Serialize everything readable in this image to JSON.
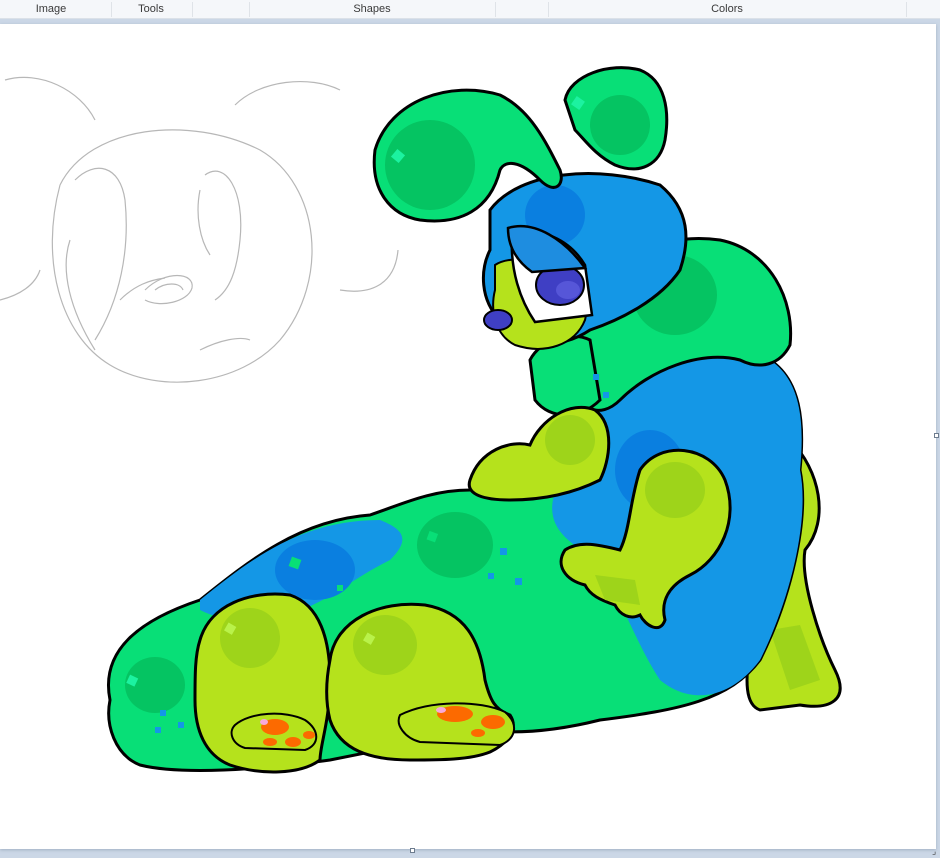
{
  "ribbon": {
    "groups": [
      {
        "label": "Image"
      },
      {
        "label": "Tools"
      },
      {
        "label": "Shapes"
      },
      {
        "label": "Colors"
      }
    ]
  },
  "palette": {
    "outline": "#000000",
    "body_green": "#08df77",
    "spot_green": "#05c462",
    "body_blue": "#1497e6",
    "spot_blue": "#0a7fe0",
    "lime": "#b5e21c",
    "lime_spot": "#97d90f",
    "paw_orange": "#fc6a00",
    "eye_purple": "#3f3fc4",
    "sketch_gray": "#b7b7b7",
    "canvas_bg": "#ffffff"
  }
}
